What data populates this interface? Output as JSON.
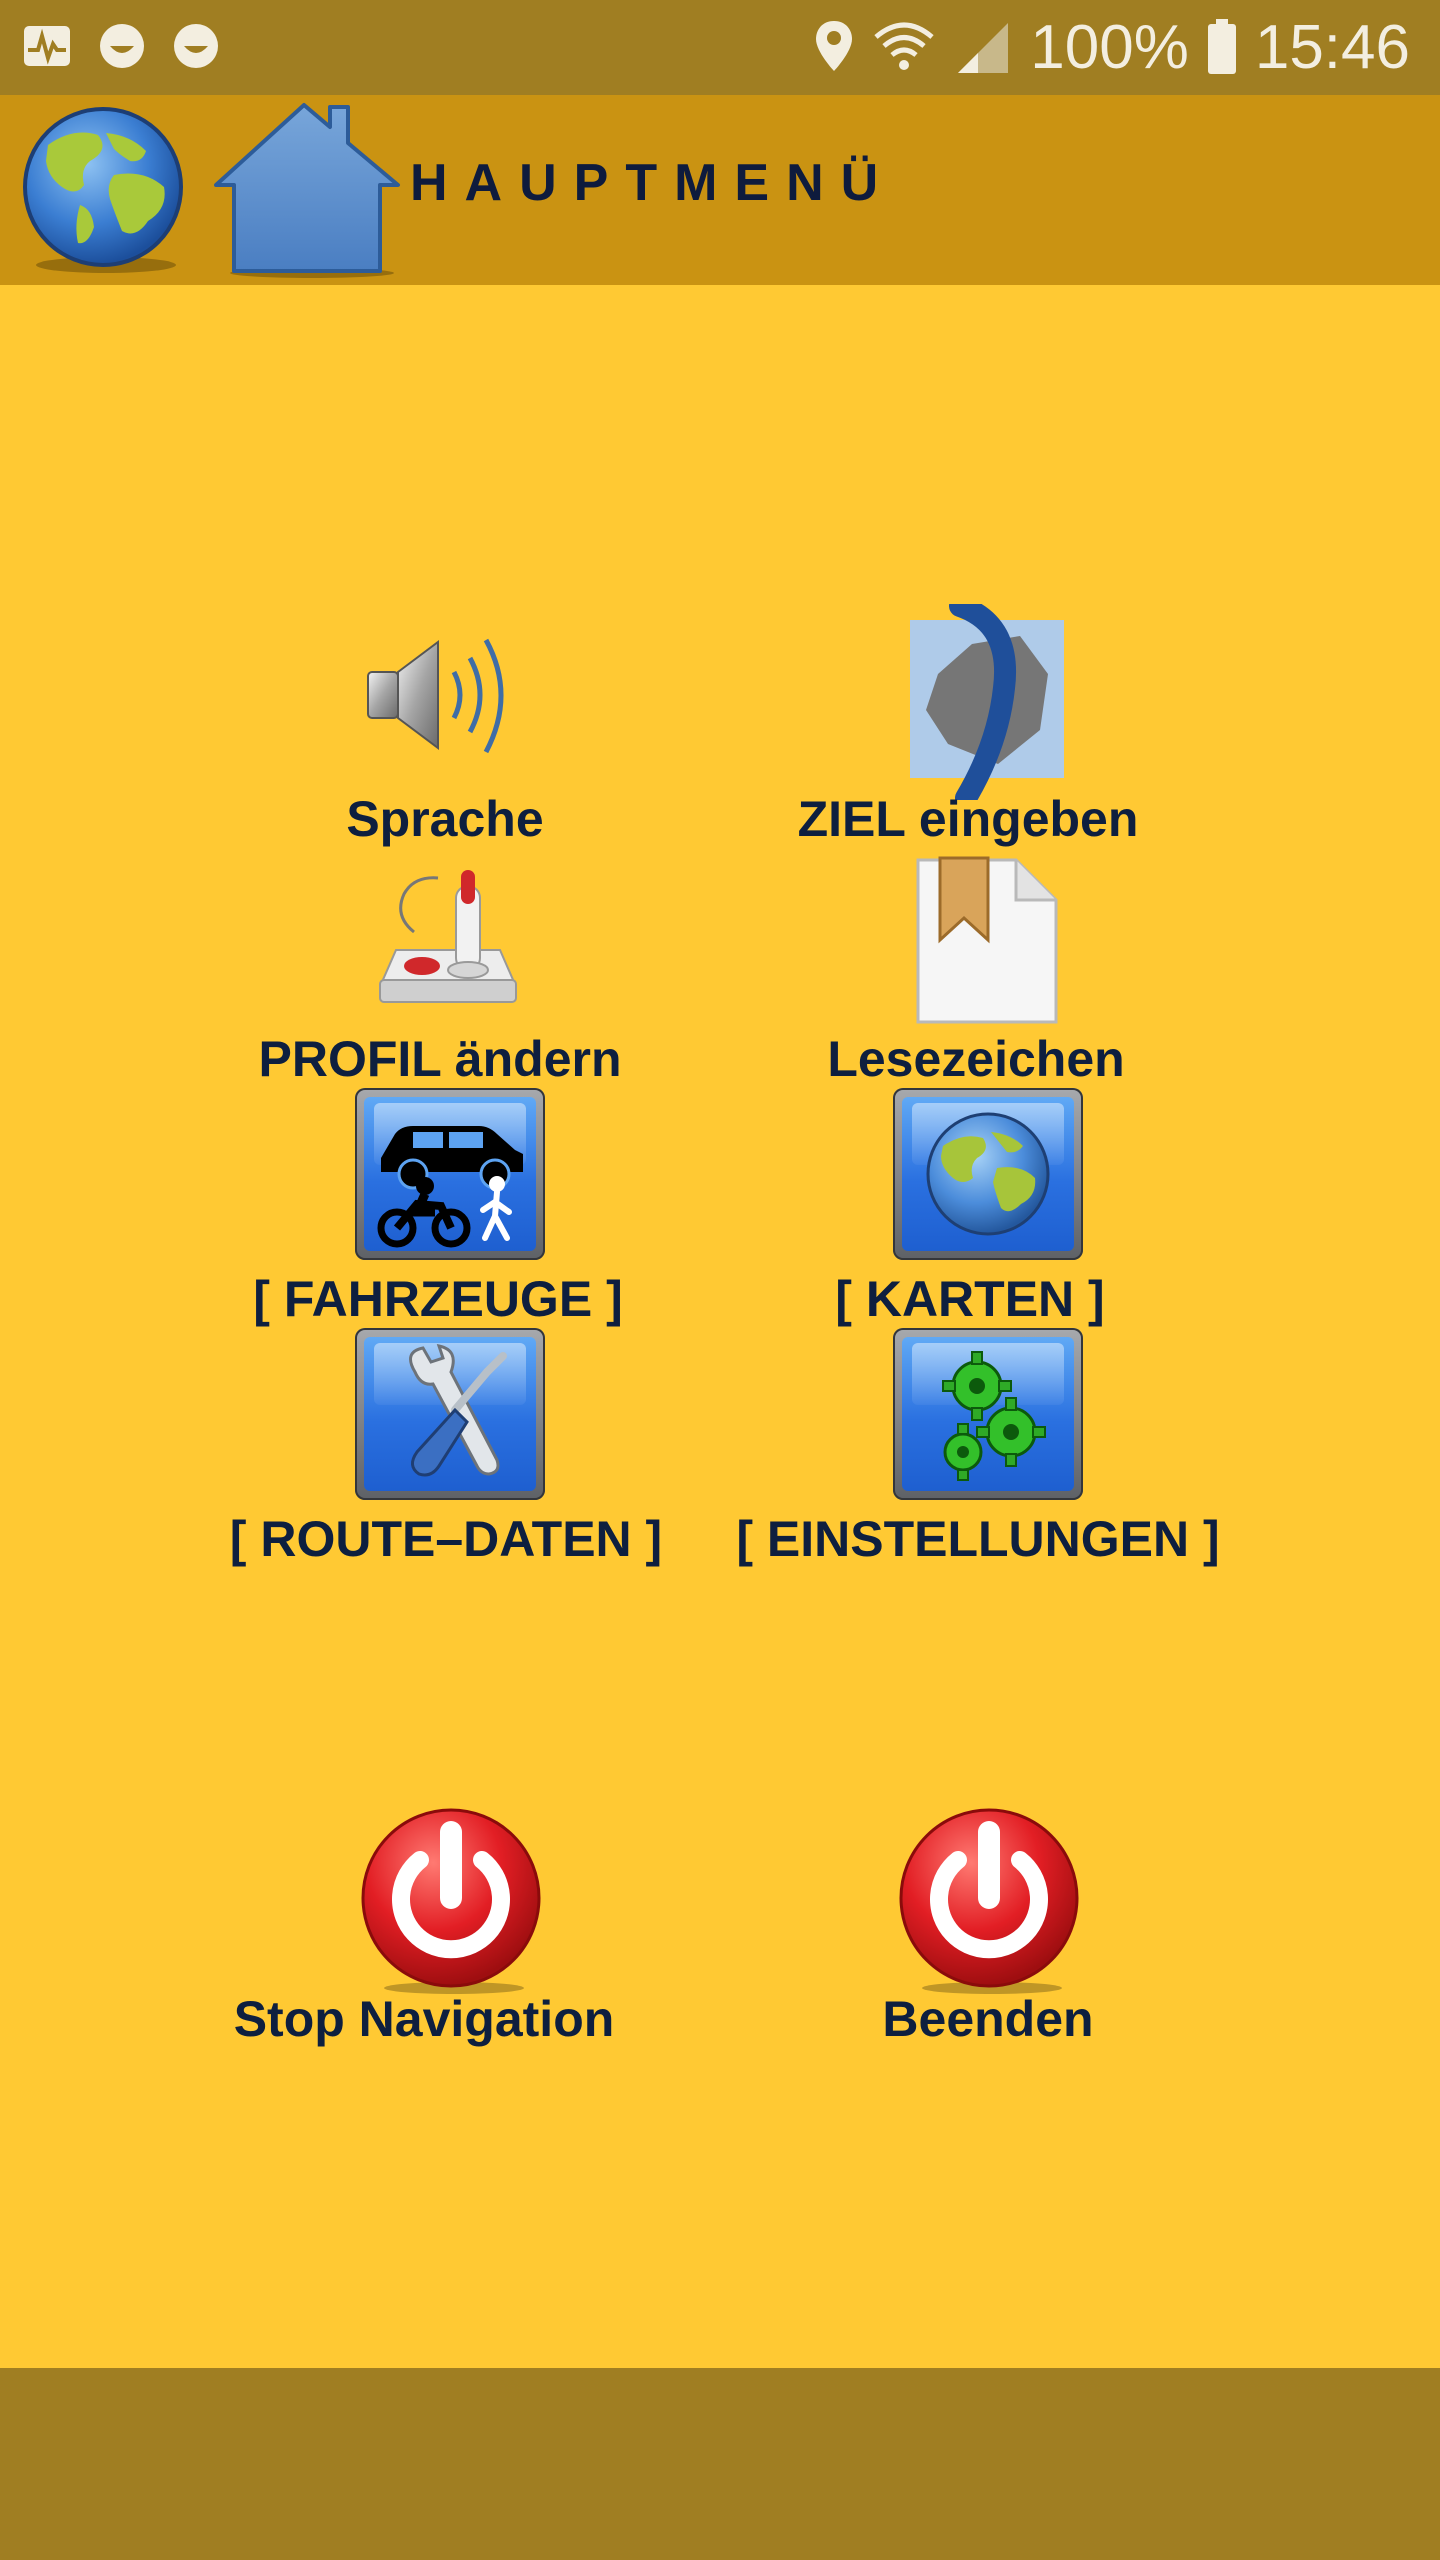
{
  "status_bar": {
    "battery": "100%",
    "time": "15:46"
  },
  "app_bar": {
    "title": "HAUPTMENÜ"
  },
  "menu": {
    "items": [
      {
        "label": "Sprache"
      },
      {
        "label": "ZIEL eingeben"
      },
      {
        "label": "PROFIL ändern"
      },
      {
        "label": "Lesezeichen"
      },
      {
        "label": "[ FAHRZEUGE ]"
      },
      {
        "label": "[ KARTEN ]"
      },
      {
        "label": "[ ROUTE–DATEN ]"
      },
      {
        "label": "[ EINSTELLUNGEN ]"
      },
      {
        "label": "Stop Navigation"
      },
      {
        "label": "Beenden"
      }
    ]
  },
  "colors": {
    "background": "#FFC933",
    "status_bar": "#A07E22",
    "app_bar": "#CA9312",
    "label_text": "#0E1F3F"
  },
  "icons": [
    "activity-icon",
    "smiley-icon",
    "smiley-icon",
    "location-icon",
    "wifi-icon",
    "signal-icon",
    "battery-icon",
    "globe-icon",
    "home-icon",
    "speaker-icon",
    "destination-icon",
    "joystick-icon",
    "bookmark-icon",
    "vehicles-icon",
    "maps-globe-icon",
    "tools-icon",
    "gears-icon",
    "power-icon"
  ]
}
